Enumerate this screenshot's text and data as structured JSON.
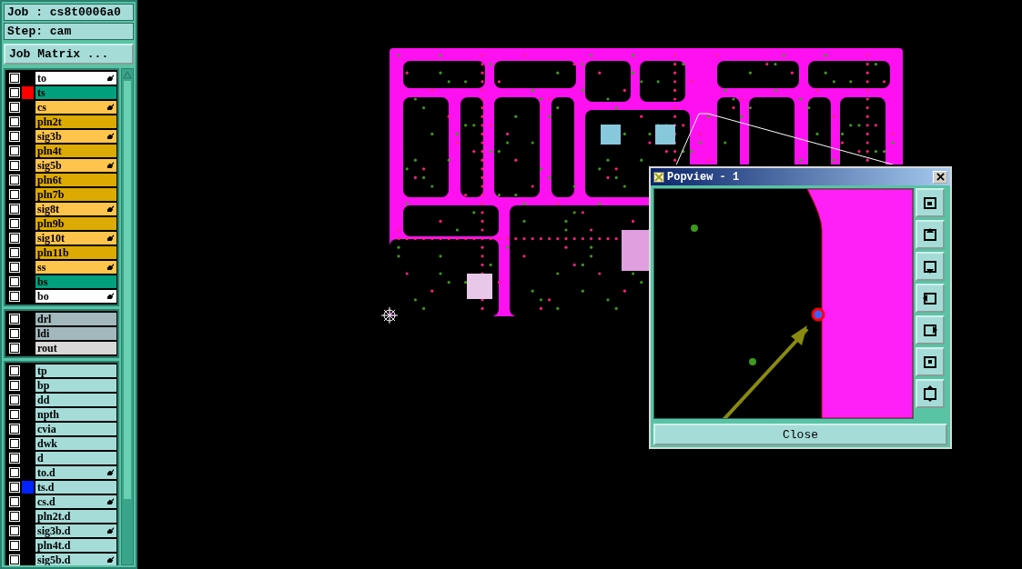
{
  "job": {
    "label": "Job : cs8t0006a0"
  },
  "step": {
    "label": "Step: cam"
  },
  "job_matrix_button": {
    "label": "Job Matrix ..."
  },
  "layer_groups": [
    {
      "layers": [
        {
          "name": "to",
          "color": "#ffffff",
          "checked": false,
          "affected": true
        },
        {
          "name": "ts",
          "color": "#00a07c",
          "checked": false,
          "marker": {
            "color": "#ff0000"
          },
          "affected": false
        },
        {
          "name": "cs",
          "color": "#ffc44c",
          "checked": false,
          "affected": true
        },
        {
          "name": "pln2t",
          "color": "#dcaa00",
          "checked": false,
          "affected": false
        },
        {
          "name": "sig3b",
          "color": "#ffc44c",
          "checked": false,
          "affected": true
        },
        {
          "name": "pln4t",
          "color": "#dcaa00",
          "checked": false,
          "affected": false
        },
        {
          "name": "sig5b",
          "color": "#ffc44c",
          "checked": false,
          "affected": true
        },
        {
          "name": "pln6t",
          "color": "#dcaa00",
          "checked": false,
          "affected": false
        },
        {
          "name": "pln7b",
          "color": "#dcaa00",
          "checked": false,
          "affected": false
        },
        {
          "name": "sig8t",
          "color": "#ffc44c",
          "checked": false,
          "affected": true
        },
        {
          "name": "pln9b",
          "color": "#dcaa00",
          "checked": false,
          "affected": false
        },
        {
          "name": "sig10t",
          "color": "#ffc44c",
          "checked": false,
          "affected": true
        },
        {
          "name": "pln11b",
          "color": "#dcaa00",
          "checked": false,
          "affected": false
        },
        {
          "name": "ss",
          "color": "#ffc44c",
          "checked": false,
          "affected": true
        },
        {
          "name": "bs",
          "color": "#00a07c",
          "checked": false,
          "affected": false
        },
        {
          "name": "bo",
          "color": "#ffffff",
          "checked": false,
          "affected": true
        }
      ]
    },
    {
      "layers": [
        {
          "name": "drl",
          "color": "#a2b8bc",
          "checked": false,
          "affected": false
        },
        {
          "name": "ldi",
          "color": "#a2b8bc",
          "checked": false,
          "affected": false
        },
        {
          "name": "rout",
          "color": "#d8d8d8",
          "checked": false,
          "affected": false
        }
      ]
    },
    {
      "layers": [
        {
          "name": "tp",
          "color": "#a6dcd8",
          "checked": false,
          "affected": false
        },
        {
          "name": "bp",
          "color": "#a6dcd8",
          "checked": false,
          "affected": false
        },
        {
          "name": "dd",
          "color": "#a6dcd8",
          "checked": false,
          "affected": false
        },
        {
          "name": "npth",
          "color": "#a6dcd8",
          "checked": false,
          "affected": false
        },
        {
          "name": "cvia",
          "color": "#a6dcd8",
          "checked": false,
          "affected": false
        },
        {
          "name": "dwk",
          "color": "#a6dcd8",
          "checked": false,
          "affected": false
        },
        {
          "name": "d",
          "color": "#a6dcd8",
          "checked": false,
          "affected": false
        },
        {
          "name": "to.d",
          "color": "#a6dcd8",
          "checked": false,
          "affected": true
        },
        {
          "name": "ts.d",
          "color": "#a6dcd8",
          "checked": false,
          "marker": {
            "color": "#0022ff"
          },
          "affected": false
        },
        {
          "name": "cs.d",
          "color": "#a6dcd8",
          "checked": false,
          "affected": true
        },
        {
          "name": "pln2t.d",
          "color": "#a6dcd8",
          "checked": false,
          "affected": false
        },
        {
          "name": "sig3b.d",
          "color": "#a6dcd8",
          "checked": false,
          "affected": true
        },
        {
          "name": "pln4t.d",
          "color": "#a6dcd8",
          "checked": false,
          "affected": false
        },
        {
          "name": "sig5b.d",
          "color": "#a6dcd8",
          "checked": false,
          "affected": true
        }
      ]
    }
  ],
  "popview": {
    "title": "Popview - 1",
    "close_label": "Close"
  }
}
